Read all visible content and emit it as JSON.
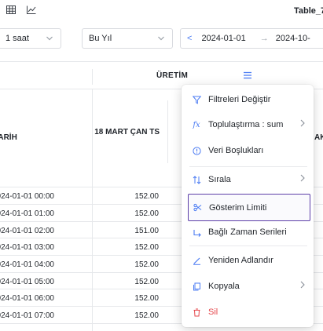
{
  "toolbar": {
    "title": "Table_7",
    "view_icons": [
      "table-view-icon",
      "chart-view-icon"
    ]
  },
  "filters": {
    "interval": "1 saat",
    "period": "Bu Yıl",
    "date_prefix": "<",
    "date_from": "2024-01-01",
    "date_arrow": "→",
    "date_to": "2024-10-"
  },
  "table": {
    "group_header": "ÜRETİM",
    "columns": [
      "TARİH",
      "18 MART ÇAN TS",
      "AK"
    ],
    "rows": [
      {
        "date": "2024-01-01 00:00",
        "value": "152.00"
      },
      {
        "date": "2024-01-01 01:00",
        "value": "152.00"
      },
      {
        "date": "2024-01-01 02:00",
        "value": "151.00"
      },
      {
        "date": "2024-01-01 03:00",
        "value": "152.00"
      },
      {
        "date": "2024-01-01 04:00",
        "value": "152.00"
      },
      {
        "date": "2024-01-01 05:00",
        "value": "152.00"
      },
      {
        "date": "2024-01-01 06:00",
        "value": "152.00"
      },
      {
        "date": "2024-01-01 07:00",
        "value": "152.00"
      }
    ]
  },
  "context_menu": {
    "items": [
      {
        "label": "Filtreleri Değiştir",
        "icon": "filter-icon"
      },
      {
        "label": "Toplulaştırma : sum",
        "icon": "function-icon",
        "submenu": true
      },
      {
        "label": "Veri Boşlukları",
        "icon": "info-circle-icon"
      },
      {
        "label": "Sırala",
        "icon": "sort-icon",
        "submenu": true
      },
      {
        "label": "Gösterim Limiti",
        "icon": "scissors-icon",
        "active": true
      },
      {
        "label": "Bağlı Zaman Serileri",
        "icon": "link-icon"
      },
      {
        "label": "Yeniden Adlandır",
        "icon": "edit-icon"
      },
      {
        "label": "Kopyala",
        "icon": "copy-icon",
        "submenu": true
      },
      {
        "label": "Sil",
        "icon": "trash-icon",
        "danger": true
      }
    ],
    "colors": {
      "accent": "#4c7cf3",
      "active_border": "#5c3ea8",
      "danger": "#e5484d"
    }
  }
}
